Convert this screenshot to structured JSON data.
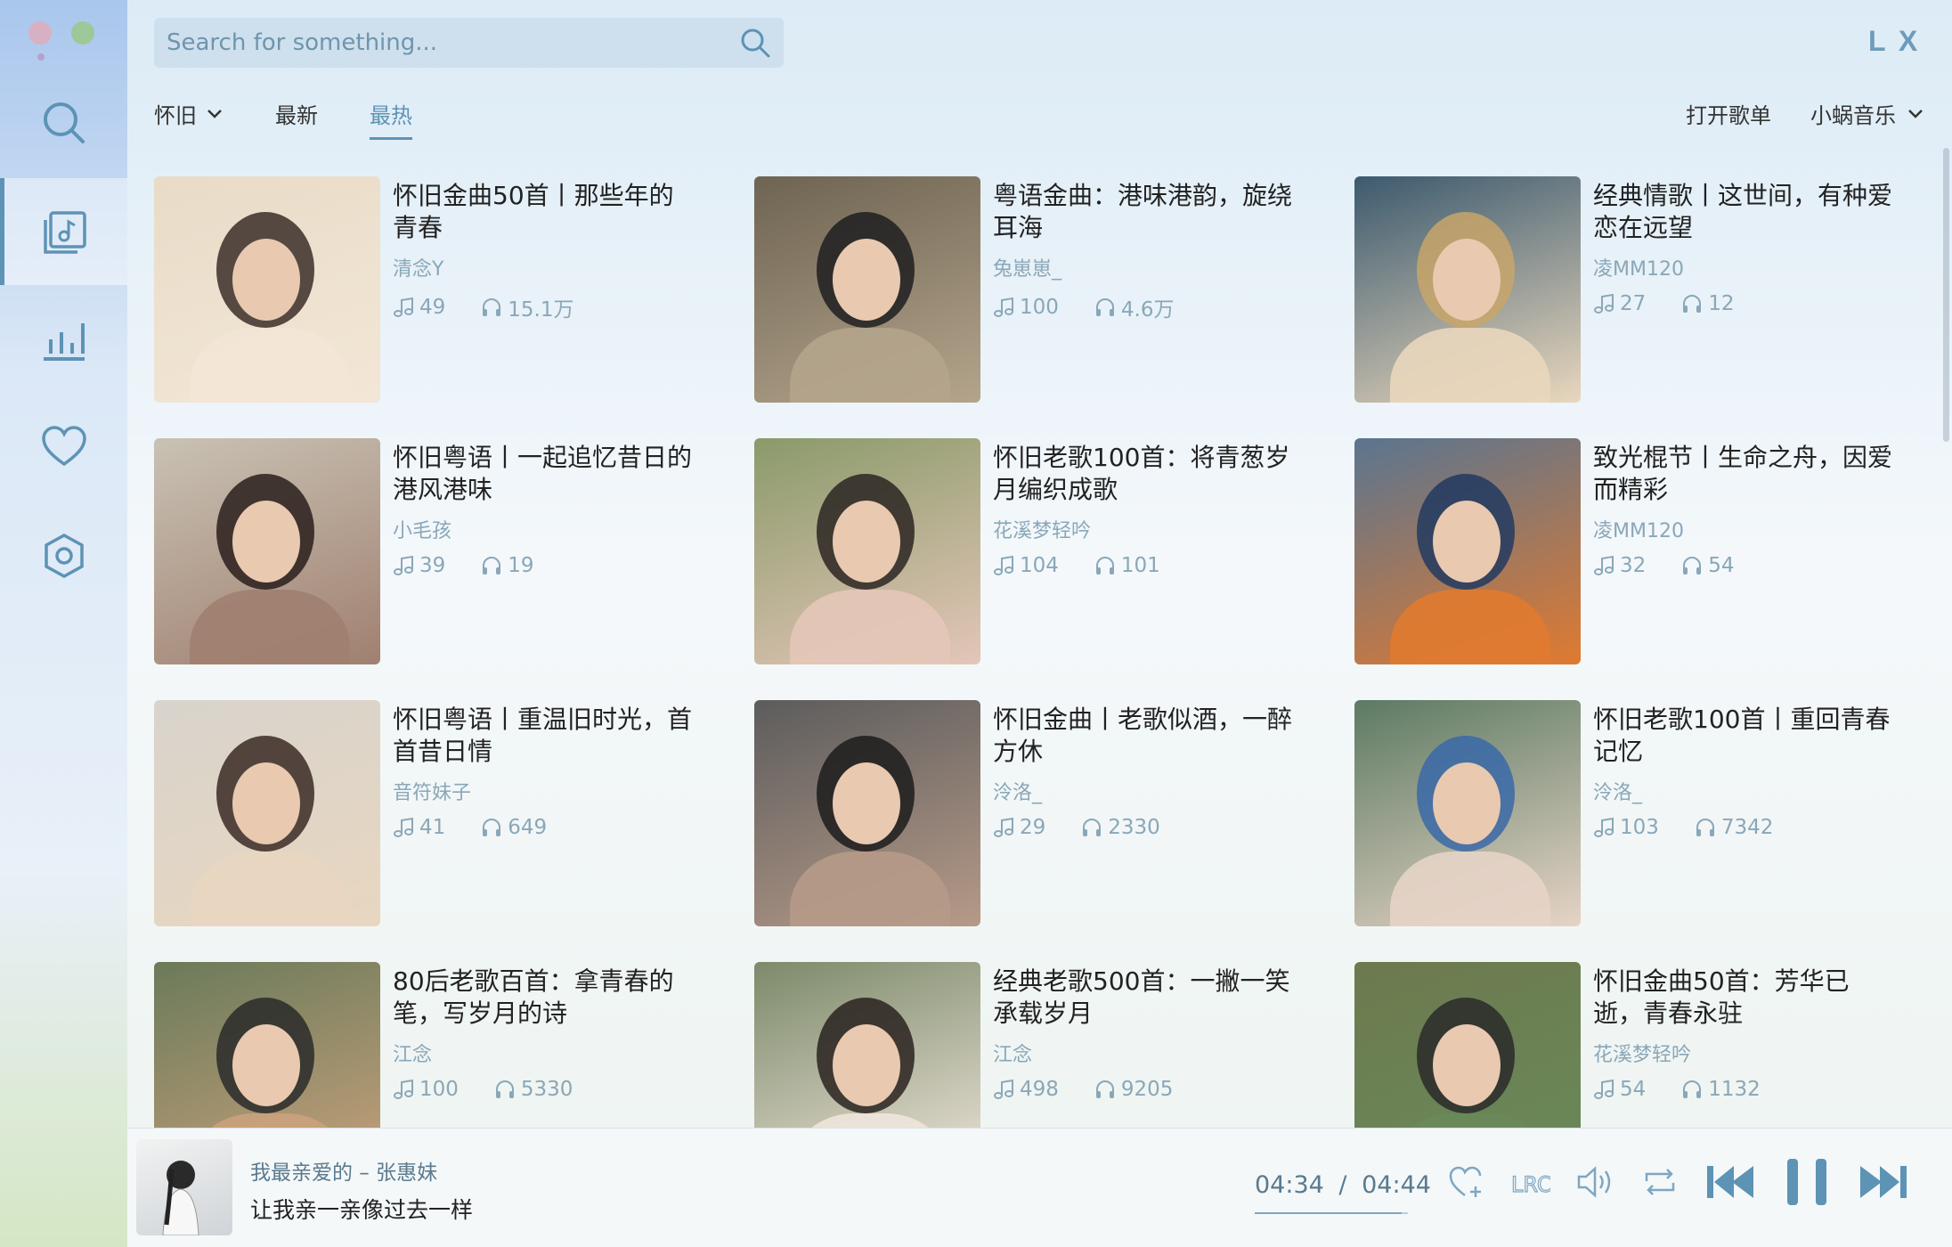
{
  "window": {
    "brand": "L X"
  },
  "search": {
    "placeholder": "Search for something..."
  },
  "tabs": {
    "category": "怀旧",
    "items": [
      "最新",
      "最热"
    ],
    "active": "最热",
    "open_playlist": "打开歌单",
    "source": "小蜗音乐"
  },
  "playlists": [
    {
      "title": "怀旧金曲50首丨那些年的青春",
      "author": "清念Y",
      "songs": "49",
      "plays": "15.1万"
    },
    {
      "title": "粤语金曲：港味港韵，旋绕耳海",
      "author": "兔崽崽_",
      "songs": "100",
      "plays": "4.6万"
    },
    {
      "title": "经典情歌丨这世间，有种爱恋在远望",
      "author": "凌MM120",
      "songs": "27",
      "plays": "12"
    },
    {
      "title": "怀旧粤语丨一起追忆昔日的港风港味",
      "author": "小毛孩",
      "songs": "39",
      "plays": "19"
    },
    {
      "title": "怀旧老歌100首：将青葱岁月编织成歌",
      "author": "花溪梦轻吟",
      "songs": "104",
      "plays": "101"
    },
    {
      "title": "致光棍节丨生命之舟，因爱而精彩",
      "author": "凌MM120",
      "songs": "32",
      "plays": "54"
    },
    {
      "title": "怀旧粤语丨重温旧时光，首首昔日情",
      "author": "音符妹子",
      "songs": "41",
      "plays": "649"
    },
    {
      "title": "怀旧金曲丨老歌似酒，一醉方休",
      "author": "泠洛_",
      "songs": "29",
      "plays": "2330"
    },
    {
      "title": "怀旧老歌100首丨重回青春记忆",
      "author": "泠洛_",
      "songs": "103",
      "plays": "7342"
    },
    {
      "title": "80后老歌百首：拿青春的笔，写岁月的诗",
      "author": "江念",
      "songs": "100",
      "plays": "5330"
    },
    {
      "title": "经典老歌500首：一撇一笑承载岁月",
      "author": "江念",
      "songs": "498",
      "plays": "9205"
    },
    {
      "title": "怀旧金曲50首：芳华已逝，青春永驻",
      "author": "花溪梦轻吟",
      "songs": "54",
      "plays": "1132"
    }
  ],
  "player": {
    "song": "我最亲爱的 – 张惠妹",
    "lyric": "让我亲一亲像过去一样",
    "current_time": "04:34",
    "separator": "/",
    "total_time": "04:44",
    "progress": 0.96
  },
  "colors": {
    "accent": "#5d93b5",
    "muted": "#8aa7b8"
  },
  "icons": [
    "search-icon",
    "playlist-icon",
    "chart-icon",
    "heart-icon",
    "settings-icon",
    "music-note-icon",
    "headphones-icon",
    "chevron-down-icon",
    "heart-add-icon",
    "lyric-icon",
    "volume-icon",
    "repeat-icon",
    "prev-icon",
    "pause-icon",
    "next-icon"
  ]
}
